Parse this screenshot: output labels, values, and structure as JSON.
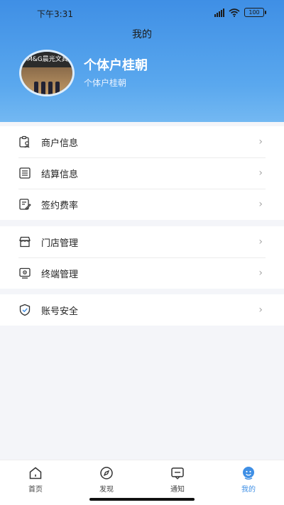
{
  "status_bar": {
    "time": "下午3:31",
    "battery": "100"
  },
  "header": {
    "title": "我的"
  },
  "profile": {
    "name": "个体户桂朝",
    "subtitle": "个体户桂朝",
    "avatar_sign_text": "M&G晨光文具"
  },
  "groups": [
    {
      "items": [
        {
          "label": "商户信息",
          "icon": "merchant-info-icon"
        },
        {
          "label": "结算信息",
          "icon": "settlement-icon"
        },
        {
          "label": "签约费率",
          "icon": "contract-rate-icon"
        }
      ]
    },
    {
      "items": [
        {
          "label": "门店管理",
          "icon": "store-icon"
        },
        {
          "label": "终端管理",
          "icon": "terminal-icon"
        }
      ]
    },
    {
      "items": [
        {
          "label": "账号安全",
          "icon": "shield-icon"
        }
      ]
    }
  ],
  "tabs": [
    {
      "label": "首页",
      "icon": "home-icon"
    },
    {
      "label": "发现",
      "icon": "compass-icon"
    },
    {
      "label": "通知",
      "icon": "message-icon"
    },
    {
      "label": "我的",
      "icon": "user-icon",
      "active": true
    }
  ],
  "colors": {
    "accent": "#3f8fe5",
    "chevron": "#a6a6a6",
    "background": "#f4f5f9"
  }
}
